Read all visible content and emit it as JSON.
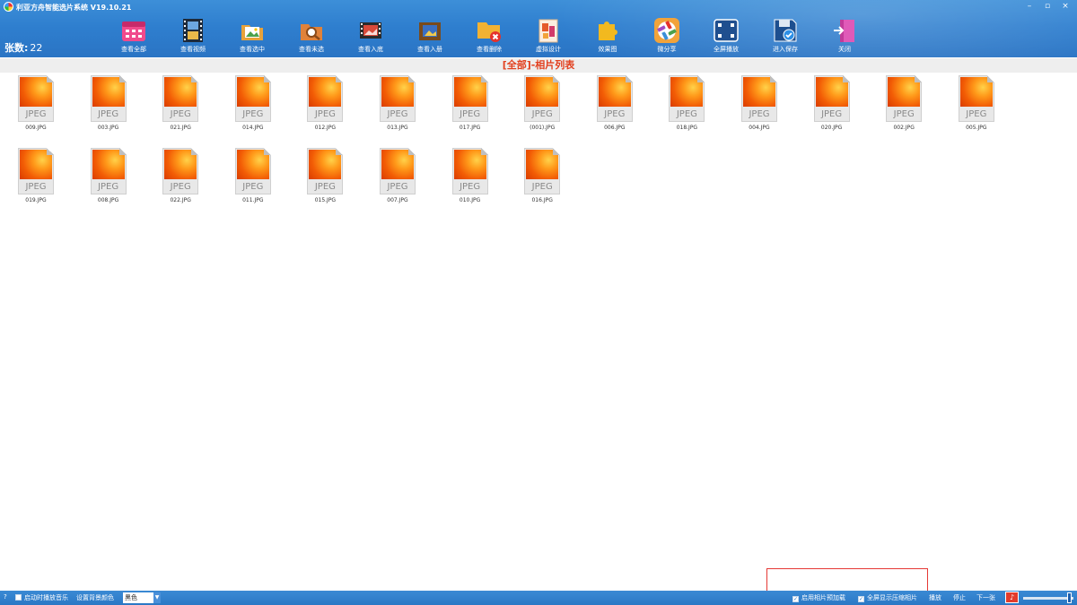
{
  "window": {
    "title": "利亚方舟智能选片系统 V19.10.21",
    "controls": [
      "–",
      "▫",
      "×"
    ]
  },
  "count": {
    "label": "张数:",
    "value": "22"
  },
  "toolbar": [
    {
      "label": "查看全部",
      "icon": "calendar-grid-icon"
    },
    {
      "label": "查看视频",
      "icon": "film-icon"
    },
    {
      "label": "查看选中",
      "icon": "photo-folder-icon"
    },
    {
      "label": "查看未选",
      "icon": "search-folder-icon"
    },
    {
      "label": "查看入底",
      "icon": "film-frame-icon"
    },
    {
      "label": "查看入册",
      "icon": "album-icon"
    },
    {
      "label": "查看删除",
      "icon": "folder-delete-icon"
    },
    {
      "label": "虚拟设计",
      "icon": "design-doc-icon"
    },
    {
      "label": "效果图",
      "icon": "puzzle-icon"
    },
    {
      "label": "微分享",
      "icon": "aperture-icon"
    },
    {
      "label": "全屏播放",
      "icon": "fullscreen-icon"
    },
    {
      "label": "进入保存",
      "icon": "save-icon"
    },
    {
      "label": "关闭",
      "icon": "exit-door-icon"
    }
  ],
  "section_title": "[全部]-相片列表",
  "photos": [
    {
      "file_type": "JPEG",
      "name": "009.JPG"
    },
    {
      "file_type": "JPEG",
      "name": "003.JPG"
    },
    {
      "file_type": "JPEG",
      "name": "021.JPG"
    },
    {
      "file_type": "JPEG",
      "name": "014.JPG"
    },
    {
      "file_type": "JPEG",
      "name": "012.JPG"
    },
    {
      "file_type": "JPEG",
      "name": "013.JPG"
    },
    {
      "file_type": "JPEG",
      "name": "017.JPG"
    },
    {
      "file_type": "JPEG",
      "name": "(001).JPG"
    },
    {
      "file_type": "JPEG",
      "name": "006.JPG"
    },
    {
      "file_type": "JPEG",
      "name": "018.JPG"
    },
    {
      "file_type": "JPEG",
      "name": "004.JPG"
    },
    {
      "file_type": "JPEG",
      "name": "020.JPG"
    },
    {
      "file_type": "JPEG",
      "name": "002.JPG"
    },
    {
      "file_type": "JPEG",
      "name": "005.JPG"
    },
    {
      "file_type": "JPEG",
      "name": "019.JPG"
    },
    {
      "file_type": "JPEG",
      "name": "008.JPG"
    },
    {
      "file_type": "JPEG",
      "name": "022.JPG"
    },
    {
      "file_type": "JPEG",
      "name": "011.JPG"
    },
    {
      "file_type": "JPEG",
      "name": "015.JPG"
    },
    {
      "file_type": "JPEG",
      "name": "007.JPG"
    },
    {
      "file_type": "JPEG",
      "name": "010.JPG"
    },
    {
      "file_type": "JPEG",
      "name": "016.JPG"
    }
  ],
  "statusbar": {
    "help": "?",
    "autoplay_music": {
      "label": "启动时播放音乐",
      "checked": false
    },
    "bg_color_label": "设置背景颜色",
    "bg_color_value": "黑色",
    "preload": {
      "label": "启用相片预加载",
      "checked": true
    },
    "fullscreen_compress": {
      "label": "全屏显示压缩相片",
      "checked": true
    },
    "play_label": "播放",
    "stop_label": "停止",
    "next_label": "下一张"
  },
  "colors": {
    "header_blue": "#2f7fcf",
    "title_red": "#e2401f",
    "highlight_red": "#e53935"
  }
}
